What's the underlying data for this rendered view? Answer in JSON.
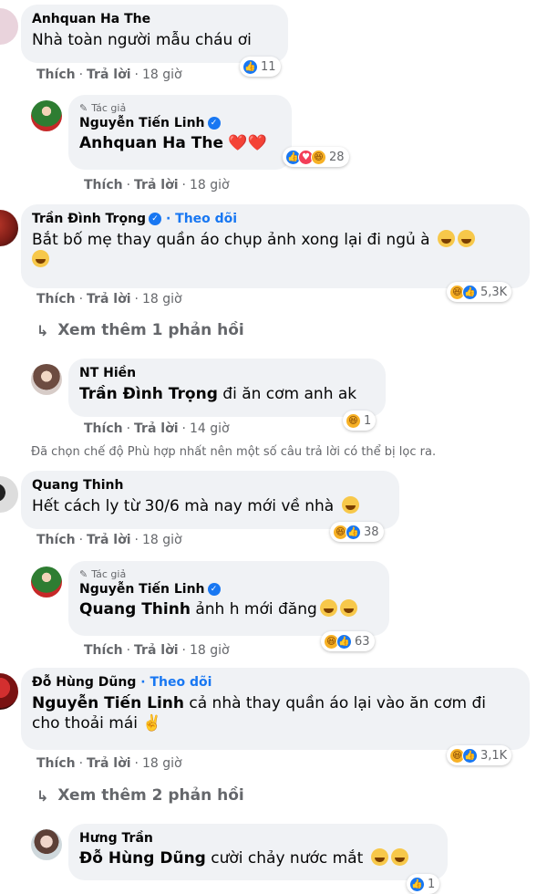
{
  "actions": {
    "like": "Thích",
    "reply": "Trả lời"
  },
  "author_label": "Tác giả",
  "follow_label": "Theo dõi",
  "comments": [
    {
      "name": "Anhquan Ha The",
      "text": "Nhà toàn người mẫu cháu ơi",
      "time": "18 giờ",
      "reaction_count": "11"
    },
    {
      "name": "Nguyễn Tiến Linh",
      "mention": "Anhquan Ha The",
      "text": "❤️❤️",
      "time": "18 giờ",
      "reaction_count": "28"
    },
    {
      "name": "Trần Đình Trọng",
      "text": "Bắt bố mẹ thay quần áo chụp ảnh xong lại đi ngủ à",
      "time": "18 giờ",
      "reaction_count": "5,3K"
    },
    {
      "name": "NT Hiền",
      "mention": "Trần Đình Trọng",
      "text": "đi ăn cơm anh ak",
      "time": "14 giờ",
      "reaction_count": "1"
    },
    {
      "name": "Quang Thinh",
      "text": "Hết cách ly từ 30/6 mà nay mới về nhà",
      "time": "18 giờ",
      "reaction_count": "38"
    },
    {
      "name": "Nguyễn Tiến Linh",
      "mention": "Quang Thinh",
      "text": "ảnh h mới đăng",
      "time": "18 giờ",
      "reaction_count": "63"
    },
    {
      "name": "Đỗ Hùng Dũng",
      "mention": "Nguyễn Tiến Linh",
      "text": "cả nhà thay quần áo lại vào ăn cơm đi",
      "text2": "cho thoải mái ✌️",
      "time": "18 giờ",
      "reaction_count": "3,1K"
    },
    {
      "name": "Hưng Trần",
      "mention": "Đỗ Hùng Dũng",
      "text": "cười chảy nước mắt",
      "reaction_count": "1"
    }
  ],
  "view_more": [
    "Xem thêm 1 phản hồi",
    "Xem thêm 2 phản hồi"
  ],
  "filter_notice": "Đã chọn chế độ Phù hợp nhất nên một số câu trả lời có thể bị lọc ra.",
  "colors": {
    "bubble": "#f0f2f5",
    "link": "#1877f2",
    "meta": "#65676b"
  }
}
